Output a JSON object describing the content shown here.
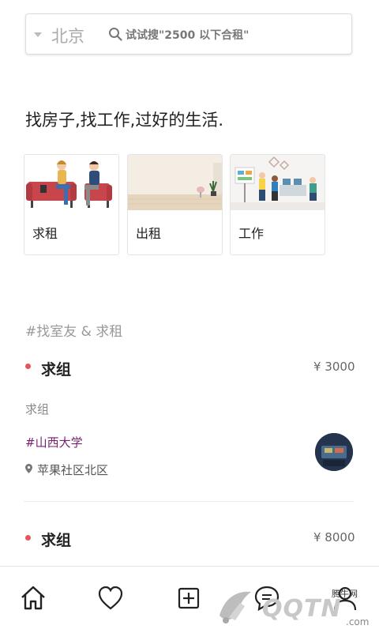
{
  "search": {
    "city": "北京",
    "placeholder": "试试搜\"2500 以下合租\""
  },
  "slogan": "找房子,找工作,过好的生活.",
  "categories": [
    {
      "label": "求租",
      "icon": "couple-talking-illustration"
    },
    {
      "label": "出租",
      "icon": "empty-room-illustration"
    },
    {
      "label": "工作",
      "icon": "office-team-illustration"
    }
  ],
  "section": {
    "title": "#找室友 & 求租"
  },
  "posts": [
    {
      "title": "求组",
      "price": "¥ 3000",
      "subtitle": "求组",
      "tag": "#山西大学",
      "location": "苹果社区北区"
    },
    {
      "title": "求组",
      "price": "¥ 8000"
    }
  ],
  "tabbar": {
    "items": [
      "home-icon",
      "heart-icon",
      "add-icon",
      "message-icon",
      "profile-icon"
    ]
  },
  "watermark": {
    "brand": "QQTN",
    "small": "腾牛网",
    "suffix": ".com"
  },
  "colors": {
    "accent_dot": "#e5565b",
    "tag": "#7a1f6e",
    "divider": "#eeeeee"
  }
}
